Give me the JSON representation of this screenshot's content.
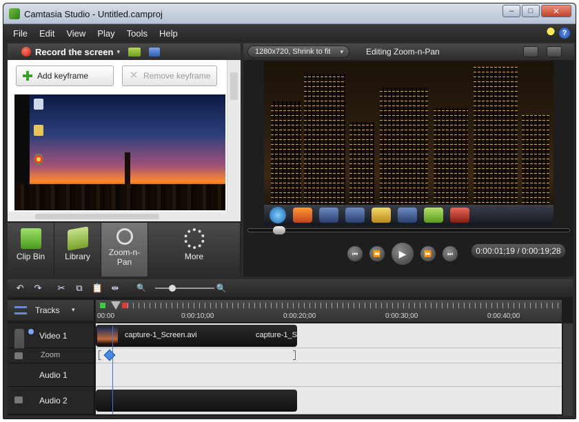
{
  "window": {
    "title": "Camtasia Studio - Untitled.camproj",
    "controls": {
      "minimize": "–",
      "maximize": "□",
      "close": "✕"
    }
  },
  "menu": {
    "items": [
      "File",
      "Edit",
      "View",
      "Play",
      "Tools",
      "Help"
    ],
    "help_glyph": "?"
  },
  "record": {
    "label": "Record the screen",
    "caret": "▾"
  },
  "keyframes": {
    "add_label": "Add keyframe",
    "remove_label": "Remove keyframe"
  },
  "tool_tabs": [
    {
      "label": "Clip Bin",
      "icon": "clip-bin-icon"
    },
    {
      "label": "Library",
      "icon": "library-icon"
    },
    {
      "label": "Zoom-n-\nPan",
      "icon": "zoom-icon",
      "active": true
    },
    {
      "label": "More",
      "icon": "more-icon"
    }
  ],
  "canvas": {
    "size_option": "1280x720, Shrink to fit",
    "caret": "▾",
    "editing_label": "Editing Zoom-n-Pan"
  },
  "player": {
    "time": "0:00:01;19 / 0:00:19;28",
    "scrub_fraction": 0.08,
    "buttons": {
      "prev": "⏮",
      "rewind": "⏪",
      "play": "▶",
      "forward": "⏩",
      "next": "⏭"
    }
  },
  "timeline": {
    "toolbar": {
      "undo": "↶",
      "redo": "↷",
      "cut": "✂",
      "copy": "⧉",
      "paste": "📋",
      "split": "⇹",
      "zoom_out": "🔍",
      "zoom_in": "🔍"
    },
    "tracks_label": "Tracks",
    "caret": "▾",
    "ruler_labels": [
      "00:00",
      "0:00:10;00",
      "0:00:20;00",
      "0:00:30;00",
      "0:00:40;00"
    ],
    "tracks": [
      {
        "name": "Video 1"
      },
      {
        "name": "Zoom"
      },
      {
        "name": "Audio 1"
      },
      {
        "name": "Audio 2"
      }
    ],
    "clips": {
      "video_title": "capture-1_Screen.avi",
      "video_title_2": "capture-1_S"
    }
  }
}
